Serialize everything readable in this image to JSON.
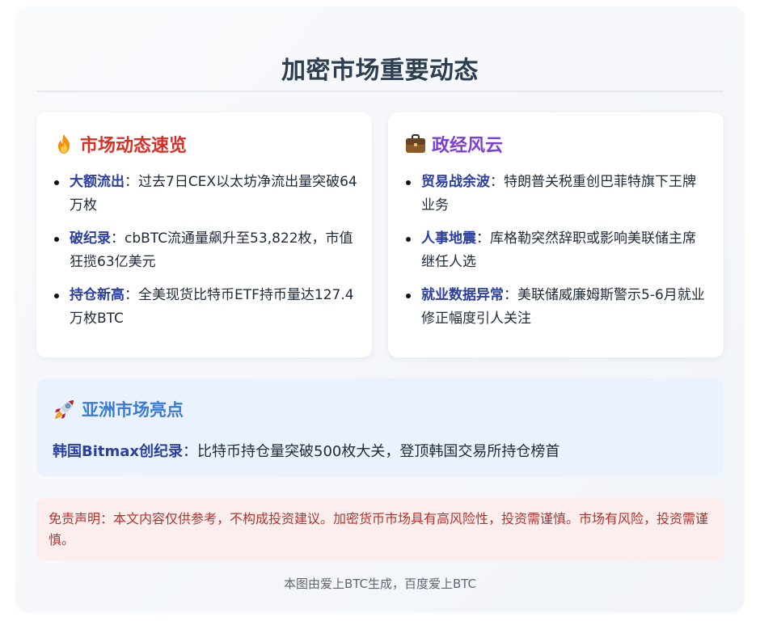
{
  "page": {
    "title": "加密市场重要动态"
  },
  "market": {
    "title": "市场动态速览",
    "icon": "fire-icon",
    "items": [
      {
        "keyword": "大额流出",
        "text": "过去7日CEX以太坊净流出量突破64万枚"
      },
      {
        "keyword": "破纪录",
        "text": "cbBTC流通量飙升至53,822枚，市值狂揽63亿美元"
      },
      {
        "keyword": "持仓新高",
        "text": "全美现货比特币ETF持币量达127.4万枚BTC"
      }
    ]
  },
  "politics": {
    "title": "政经风云",
    "icon": "briefcase-icon",
    "items": [
      {
        "keyword": "贸易战余波",
        "text": "特朗普关税重创巴菲特旗下王牌业务"
      },
      {
        "keyword": "人事地震",
        "text": "库格勒突然辞职或影响美联储主席继任人选"
      },
      {
        "keyword": "就业数据异常",
        "text": "美联储威廉姆斯警示5-6月就业修正幅度引人关注"
      }
    ]
  },
  "asia": {
    "title": "亚洲市场亮点",
    "icon": "rocket-icon",
    "keyword": "韩国Bitmax创纪录",
    "text": "比特币持仓量突破500枚大关，登顶韩国交易所持仓榜首"
  },
  "separator": "：",
  "disclaimer": "免责声明：本文内容仅供参考，不构成投资建议。加密货币市场具有高风险性，投资需谨慎。市场有风险，投资需谨慎。",
  "footer": "本图由爱上BTC生成，百度爱上BTC",
  "colors": {
    "title": "#2c3e50",
    "market_title": "#d93025",
    "politics_title": "#7e3fd8",
    "asia_title": "#3a7bd5",
    "keyword": "#2b3f9e",
    "disclaimer_text": "#b4322b",
    "disclaimer_bg": "#fdeeee",
    "asia_bg": "#e9f2fd"
  }
}
